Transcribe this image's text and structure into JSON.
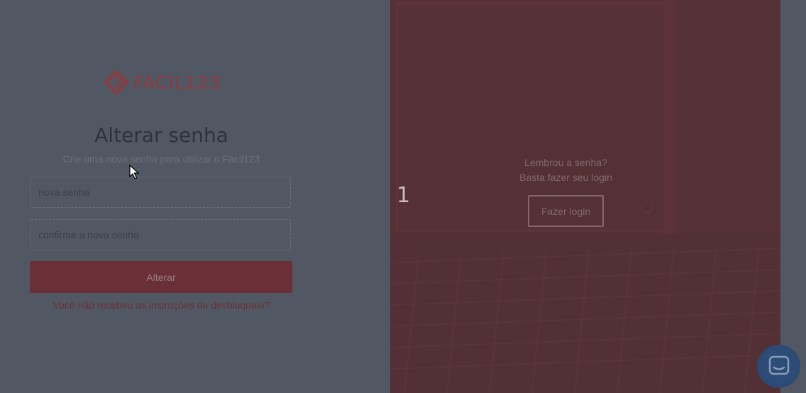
{
  "brand": {
    "logo_text": "FÁCIL123",
    "color": "#8e3a3f"
  },
  "form": {
    "title": "Alterar senha",
    "subtitle": "Crie uma nova senha para utilizar o Fácil123",
    "new_password": {
      "placeholder": "nova senha",
      "value": ""
    },
    "confirm_password": {
      "placeholder": "confirme a nova senha",
      "value": ""
    },
    "submit_label": "Alterar",
    "resend_link": "Você não recebeu as instruções de desbloqueio?"
  },
  "side": {
    "slide_number": "1",
    "remember_line1": "Lembrou a senha?",
    "remember_line2": "Basta fazer seu login",
    "login_button": "Fazer login"
  },
  "chat": {
    "icon": "chat-bubble-icon"
  },
  "colors": {
    "accent": "#6a2f37",
    "overlay_bg": "#525863",
    "panel_bg": "#553035"
  }
}
